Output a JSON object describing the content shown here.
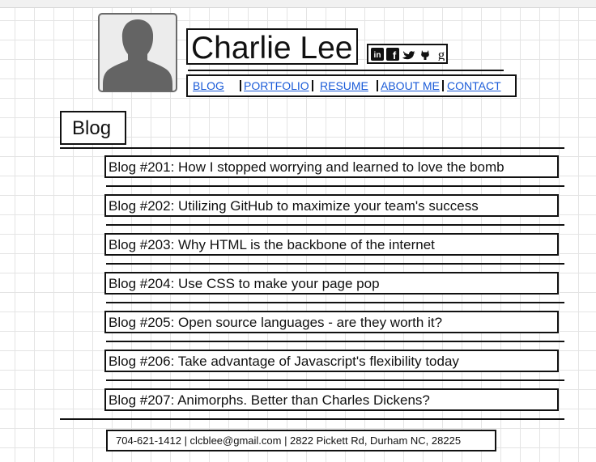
{
  "header": {
    "name": "Charlie Lee"
  },
  "social": {
    "icons": [
      "linkedin-icon",
      "facebook-icon",
      "twitter-icon",
      "github-icon",
      "google-plus-icon"
    ],
    "linkedin_text": "in",
    "facebook_text": "f",
    "google_text": "g"
  },
  "nav": {
    "items": [
      {
        "label": "BLOG"
      },
      {
        "label": "PORTFOLIO"
      },
      {
        "label": "RESUME"
      },
      {
        "label": "ABOUT ME"
      },
      {
        "label": "CONTACT"
      }
    ]
  },
  "section": {
    "title": "Blog"
  },
  "posts": [
    {
      "title": "Blog #201: How I stopped worrying and learned to love the bomb"
    },
    {
      "title": "Blog #202: Utilizing GitHub to maximize your team's success"
    },
    {
      "title": "Blog #203: Why HTML is the backbone of the internet"
    },
    {
      "title": "Blog #204: Use CSS to make your page pop"
    },
    {
      "title": "Blog #205: Open source languages - are they worth it?"
    },
    {
      "title": "Blog #206: Take advantage of Javascript's flexibility today"
    },
    {
      "title": "Blog #207: Animorphs. Better than Charles Dickens?"
    }
  ],
  "footer": {
    "text": "704-621-1412 | clcblee@gmail.com | 2822 Pickett Rd, Durham NC, 28225"
  },
  "colors": {
    "link": "#1a5bd8",
    "border": "#111111",
    "avatar": "#6a6a6a",
    "grid": "#e4e4e4"
  }
}
